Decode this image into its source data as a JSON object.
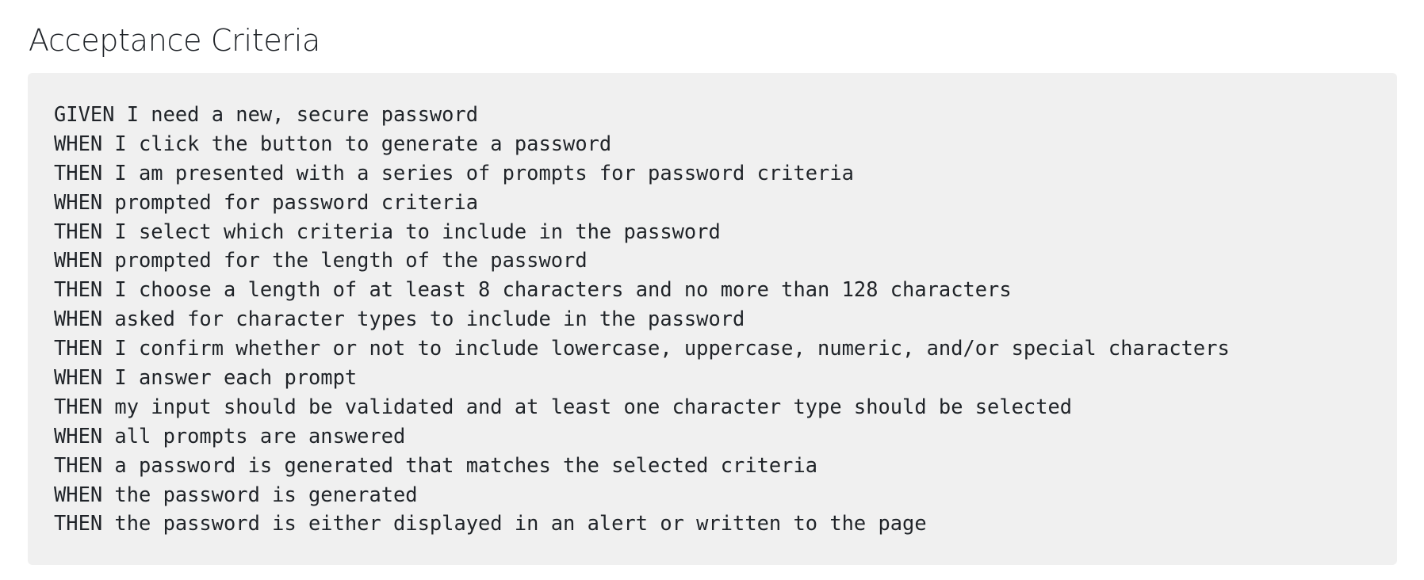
{
  "section": {
    "title": "Acceptance Criteria"
  },
  "code_block": {
    "lines": [
      "GIVEN I need a new, secure password",
      "WHEN I click the button to generate a password",
      "THEN I am presented with a series of prompts for password criteria",
      "WHEN prompted for password criteria",
      "THEN I select which criteria to include in the password",
      "WHEN prompted for the length of the password",
      "THEN I choose a length of at least 8 characters and no more than 128 characters",
      "WHEN asked for character types to include in the password",
      "THEN I confirm whether or not to include lowercase, uppercase, numeric, and/or special characters",
      "WHEN I answer each prompt",
      "THEN my input should be validated and at least one character type should be selected",
      "WHEN all prompts are answered",
      "THEN a password is generated that matches the selected criteria",
      "WHEN the password is generated",
      "THEN the password is either displayed in an alert or written to the page"
    ]
  }
}
